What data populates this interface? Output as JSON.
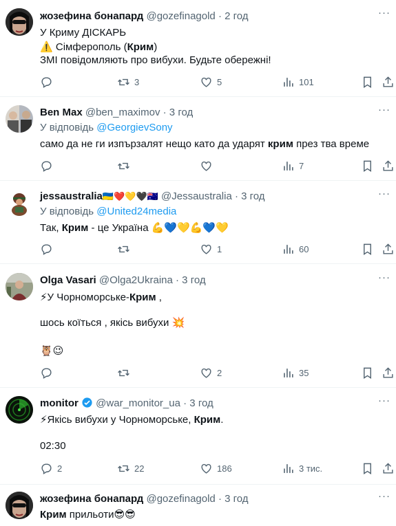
{
  "tweets": [
    {
      "name": "жозефина бонапард",
      "handle": "@gozefinagold",
      "time": "· 2 год",
      "lines": [
        "У Криму ДІСКАРЬ",
        "⚠️ Сімферополь (Крим)",
        "ЗМІ повідомляють про вибухи. Будьте обережні!"
      ],
      "counts": {
        "reply": "",
        "retweet": "3",
        "like": "5",
        "views": "101"
      }
    },
    {
      "name": "Ben Max",
      "handle": "@ben_maximov",
      "time": "· 3 год",
      "reply_prefix": "У відповідь ",
      "reply_to": "@GeorgievSony",
      "lines": [
        "само да не ги изпързалят нещо като да ударят крим през тва време"
      ],
      "counts": {
        "reply": "",
        "retweet": "",
        "like": "",
        "views": "7"
      }
    },
    {
      "name": "jessaustralia",
      "name_emoji": "🇺🇦❤️💛🖤🇦🇺",
      "handle": "@Jessaustralia",
      "time": "· 3 год",
      "reply_prefix": "У відповідь ",
      "reply_to": "@United24media",
      "lines": [
        "Так, Крим - це Україна  💪💙💛💪💙💛"
      ],
      "counts": {
        "reply": "",
        "retweet": "",
        "like": "1",
        "views": "60"
      }
    },
    {
      "name": "Olga Vasari",
      "handle": "@Olga2Ukraina",
      "time": "· 3 год",
      "lines": [
        "⚡У Чорноморське-Крим  ,",
        "шось коїться , якісь вибухи 💥",
        "🦉😉"
      ],
      "counts": {
        "reply": "",
        "retweet": "",
        "like": "2",
        "views": "35"
      }
    },
    {
      "name": "monitor",
      "handle": "@war_monitor_ua",
      "time": "· 3 год",
      "lines": [
        "⚡Якісь вибухи у Чорноморське, Крим.",
        "02:30"
      ],
      "counts": {
        "reply": "2",
        "retweet": "22",
        "like": "186",
        "views": "3 тис."
      }
    },
    {
      "name": "жозефина бонапард",
      "handle": "@gozefinagold",
      "time": "· 3 год",
      "lines": [
        "Крим прильоти😎😎"
      ]
    }
  ],
  "bold_words": [
    "Крим",
    "крим"
  ],
  "icons": [
    "reply-icon",
    "retweet-icon",
    "like-icon",
    "views-icon",
    "bookmark-icon",
    "share-icon",
    "more-icon",
    "verified-icon"
  ],
  "colors": {
    "text": "#0f1419",
    "muted": "#536471",
    "link": "#1d9bf0",
    "border": "#eff3f4"
  }
}
